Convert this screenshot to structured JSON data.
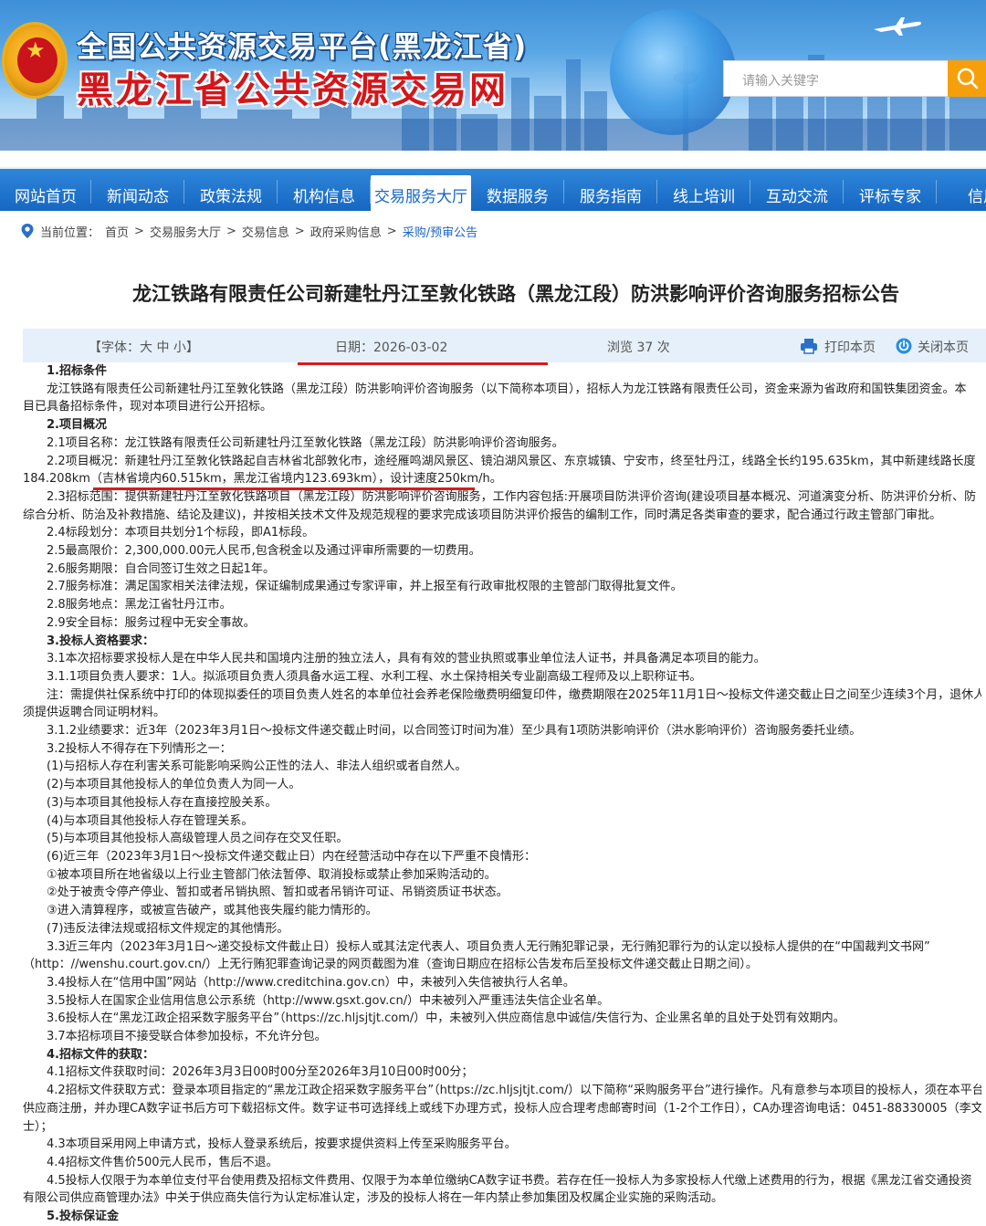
{
  "header": {
    "title_line1": "全国公共资源交易平台(黑龙江省)",
    "title_line2": "黑龙江省公共资源交易网",
    "search_placeholder": "请输入关键字"
  },
  "nav": [
    "网站首页",
    "新闻动态",
    "政策法规",
    "机构信息",
    "交易服务大厅",
    "数据服务",
    "服务指南",
    "线上培训",
    "互动交流",
    "评标专家",
    "信用"
  ],
  "breadcrumb": {
    "label": "当前位置：",
    "items": [
      "首页",
      "交易服务大厅",
      "交易信息",
      "政府采购信息",
      "采购/预审公告"
    ]
  },
  "article": {
    "title": "龙江铁路有限责任公司新建牡丹江至敦化铁路（黑龙江段）防洪影响评价咨询服务招标公告",
    "font_label": "【字体：大 中 小】",
    "date": "日期：2026-03-02",
    "views": "浏览 37 次",
    "print": "打印本页",
    "close": "关闭本页"
  },
  "body": [
    "1.招标条件",
    "龙江铁路有限责任公司新建牡丹江至敦化铁路（黑龙江段）防洪影响评价咨询服务（以下简称本项目），招标人为龙江铁路有限责任公司，资金来源为省政府和国铁集团资金。本",
    "目已具备招标条件，现对本项目进行公开招标。",
    "2.项目概况",
    "2.1项目名称：龙江铁路有限责任公司新建牡丹江至敦化铁路（黑龙江段）防洪影响评价咨询服务。",
    "2.2项目概况：新建牡丹江至敦化铁路起自吉林省北部敦化市，途经雁鸣湖风景区、镜泊湖风景区、东京城镇、宁安市，终至牡丹江，线路全长约195.635km，其中新建线路长度",
    "184.208km（吉林省境内60.515km，黑龙江省境内123.693km），设计速度250km/h。",
    "2.3招标范围：提供新建牡丹江至敦化铁路项目（黑龙江段）防洪影响评价咨询服务，工作内容包括:开展项目防洪评价咨询(建设项目基本概况、河道演变分析、防洪评价分析、防",
    "综合分析、防治及补救措施、结论及建议)，并按相关技术文件及规范规程的要求完成该项目防洪评价报告的编制工作，同时满足各类审查的要求，配合通过行政主管部门审批。",
    "2.4标段划分：本项目共划分1个标段，即A1标段。",
    "2.5最高限价：2,300,000.00元人民币,包含税金以及通过评审所需要的一切费用。",
    "2.6服务期限：自合同签订生效之日起1年。",
    "2.7服务标准：满足国家相关法律法规，保证编制成果通过专家评审，并上报至有行政审批权限的主管部门取得批复文件。",
    "2.8服务地点：黑龙江省牡丹江市。",
    "2.9安全目标：服务过程中无安全事故。",
    "3.投标人资格要求：",
    "3.1本次招标要求投标人是在中华人民共和国境内注册的独立法人，具有有效的营业执照或事业单位法人证书，并具备满足本项目的能力。",
    "3.1.1项目负责人要求：1人。拟派项目负责人须具备水运工程、水利工程、水土保持相关专业副高级工程师及以上职称证书。",
    "注：需提供社保系统中打印的体现拟委任的项目负责人姓名的本单位社会养老保险缴费明细复印件，缴费期限在2025年11月1日～投标文件递交截止日之间至少连续3个月，退休人",
    "须提供返聘合同证明材料。",
    "3.1.2业绩要求：近3年（2023年3月1日～投标文件递交截止时间，以合同签订时间为准）至少具有1项防洪影响评价（洪水影响评价）咨询服务委托业绩。",
    "3.2投标人不得存在下列情形之一：",
    "(1)与招标人存在利害关系可能影响采购公正性的法人、非法人组织或者自然人。",
    "(2)与本项目其他投标人的单位负责人为同一人。",
    "(3)与本项目其他投标人存在直接控股关系。",
    "(4)与本项目其他投标人存在管理关系。",
    "(5)与本项目其他投标人高级管理人员之间存在交叉任职。",
    "(6)近三年（2023年3月1日～投标文件递交截止日）内在经营活动中存在以下严重不良情形：",
    "①被本项目所在地省级以上行业主管部门依法暂停、取消投标或禁止参加采购活动的。",
    "②处于被责令停产停业、暂扣或者吊销执照、暂扣或者吊销许可证、吊销资质证书状态。",
    "③进入清算程序，或被宣告破产，或其他丧失履约能力情形的。",
    "(7)违反法律法规或招标文件规定的其他情形。",
    "3.3近三年内（2023年3月1日～递交投标文件截止日）投标人或其法定代表人、项目负责人无行贿犯罪记录，无行贿犯罪行为的认定以投标人提供的在“中国裁判文书网”",
    "（http：//wenshu.court.gov.cn/）上无行贿犯罪查询记录的网页截图为准（查询日期应在招标公告发布后至投标文件递交截止日期之间）。",
    "3.4投标人在“信用中国”网站（http://www.creditchina.gov.cn）中，未被列入失信被执行人名单。",
    "3.5投标人在国家企业信用信息公示系统（http://www.gsxt.gov.cn/）中未被列入严重违法失信企业名单。",
    "3.6投标人在“黑龙江政企招采数字服务平台”（https://zc.hljsjtjt.com/）中，未被列入供应商信息中诚信/失信行为、企业黑名单的且处于处罚有效期内。",
    "3.7本招标项目不接受联合体参加投标，不允许分包。",
    "4.招标文件的获取：",
    "4.1招标文件获取时间：2026年3月3日00时00分至2026年3月10日00时00分；",
    "4.2招标文件获取方式：登录本项目指定的“黑龙江政企招采数字服务平台”（https://zc.hljsjtjt.com/）以下简称“采购服务平台”进行操作。凡有意参与本项目的投标人，须在本平台",
    "供应商注册，并办理CA数字证书后方可下载招标文件。数字证书可选择线上或线下办理方式，投标人应合理考虑邮寄时间（1-2个工作日），CA办理咨询电话：0451-88330005（李文",
    "士）；",
    "4.3本项目采用网上申请方式，投标人登录系统后，按要求提供资料上传至采购服务平台。",
    "4.4招标文件售价500元人民币，售后不退。",
    "4.5投标人仅限于为本单位支付平台使用费及招标文件费用、仅限于为本单位缴纳CA数字证书费。若存在任一投标人为多家投标人代缴上述费用的行为，根据《黑龙江省交通投资",
    "有限公司供应商管理办法》中关于供应商失信行为认定标准认定，涉及的投标人将在一年内禁止参加集团及权属企业实施的采购活动。",
    "5.投标保证金"
  ]
}
